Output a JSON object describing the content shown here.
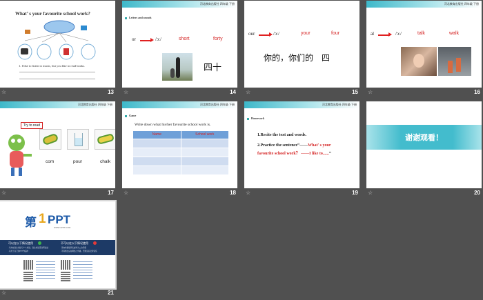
{
  "slides": [
    {
      "number": "13",
      "title": "What’ s your favourite school work?",
      "sentence": "1. I like to listen to music, but you like to read books."
    },
    {
      "number": "14",
      "brand": "河北教育出版社   四年级   下册",
      "heading": "Letters and sounds",
      "phon": "or",
      "ipa": "/ɔ:/",
      "w1": "short",
      "w2": "forty",
      "chinese": "四十"
    },
    {
      "number": "15",
      "phon": "our",
      "ipa": "/ɔ:/",
      "w1": "your",
      "w2": "four",
      "chinese": "你的，你们的　四"
    },
    {
      "number": "16",
      "brand": "河北教育出版社   四年级   下册",
      "phon": "al",
      "ipa": "/ɔ:/",
      "w1": "talk",
      "w2": "walk"
    },
    {
      "number": "17",
      "brand": "河北教育出版社   四年级   下册",
      "bubble": "Try to read",
      "w1": "com",
      "w2": "pour",
      "w3": "chalk"
    },
    {
      "number": "18",
      "brand": "河北教育出版社   四年级   下册",
      "heading": "Game",
      "instruction": "Write down what his/her favourite school work is.",
      "col1": "Name",
      "col2": "School work"
    },
    {
      "number": "19",
      "brand": "河北教育出版社   四年级   下册",
      "heading": "Homework",
      "item1": "1.Recite the text and words.",
      "item2a": "2.Practice the sentence“——",
      "item2b": "What' s your",
      "item2c": "favourite school work？ ——I like to......",
      "item2d": "”"
    },
    {
      "number": "20",
      "thanks": "谢谢观看！"
    },
    {
      "number": "21",
      "logo_a": "第",
      "logo_b": "1",
      "logo_c": "PPT",
      "logo_url": "WWW.1PPT.COM",
      "left_title": "可以在以下情况使用",
      "right_title": "不可以在以下情况使用",
      "left_lines": [
        "·可用在商业用途与个人用途，商业用途需注明出处",
        "·可用于自己的PPT作品中"
      ],
      "right_lines": [
        "·请勿将模板转卖或作为二次销售",
        "·不得修改后在网络上传播，否则追究法律责任"
      ]
    }
  ],
  "colors": {
    "accent": "#2fb3c6",
    "red": "#d42020",
    "navy": "#1d3a66",
    "table_header": "#6fa0d8"
  }
}
